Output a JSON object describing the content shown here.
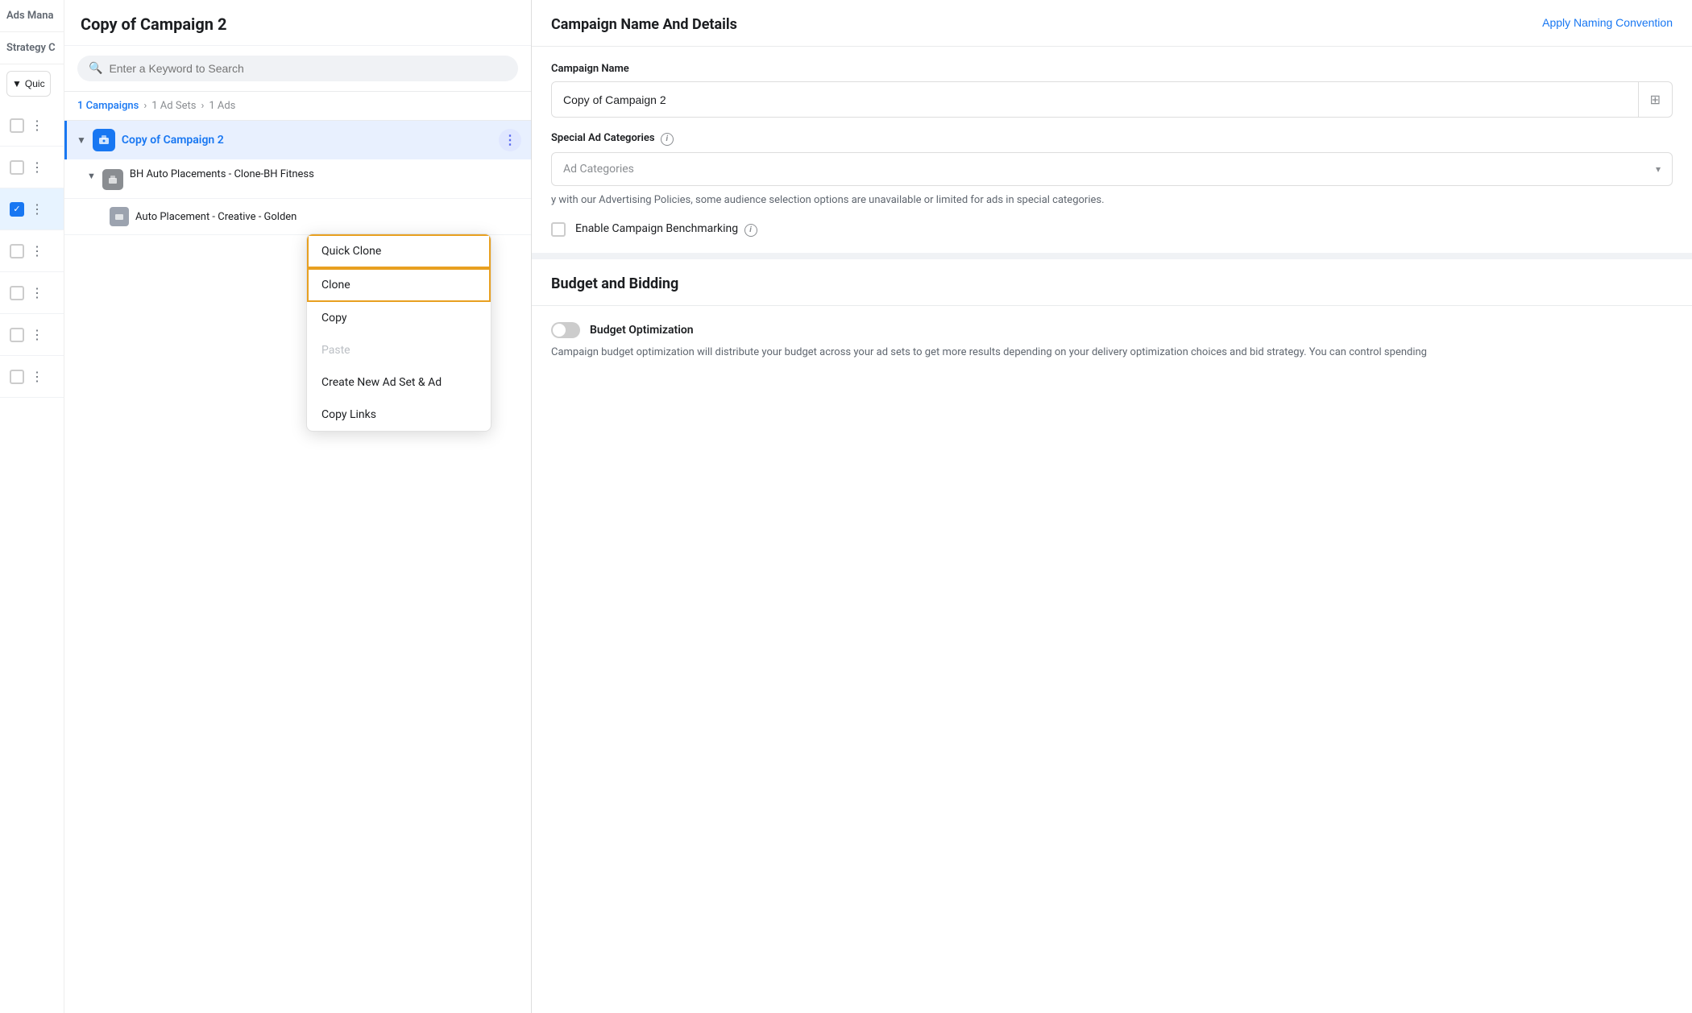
{
  "app": {
    "title": "Ads Mana",
    "panel_title": "Copy of Campaign 2"
  },
  "sidebar": {
    "strategy_label": "Strategy C",
    "quick_btn_label": "Quic",
    "checkboxes": [
      {
        "checked": false
      },
      {
        "checked": false
      },
      {
        "checked": true
      },
      {
        "checked": false
      },
      {
        "checked": false
      },
      {
        "checked": false
      },
      {
        "checked": false
      }
    ]
  },
  "tree_panel": {
    "search_placeholder": "Enter a Keyword to Search",
    "breadcrumb": {
      "campaigns": "1 Campaigns",
      "adsets": "1 Ad Sets",
      "ads": "1 Ads"
    },
    "campaign": {
      "name": "Copy of Campaign 2"
    },
    "adset": {
      "name": "BH Auto Placements - Clone-BH Fitness"
    },
    "ad": {
      "name": "Auto Placement - Creative - Golden"
    }
  },
  "context_menu": {
    "items": [
      {
        "label": "Quick Clone",
        "type": "highlighted"
      },
      {
        "label": "Clone",
        "type": "highlighted"
      },
      {
        "label": "Copy",
        "type": "normal"
      },
      {
        "label": "Paste",
        "type": "disabled"
      },
      {
        "label": "Create New Ad Set & Ad",
        "type": "normal"
      },
      {
        "label": "Copy Links",
        "type": "normal"
      }
    ]
  },
  "right_panel": {
    "section1": {
      "title": "Campaign Name And Details",
      "apply_naming": "Apply Naming Convention",
      "campaign_name_label": "Campaign Name",
      "campaign_name_value": "Copy of Campaign 2",
      "special_ad_label": "Special Ad Categories",
      "special_ad_placeholder": "Ad Categories",
      "helper_text": "y with our Advertising Policies, some audience selection options are unavailable or limited for ads in special categories.",
      "benchmarking_label": "Enable Campaign Benchmarking"
    },
    "section2": {
      "title": "Budget and Bidding",
      "budget_optimization_label": "Budget Optimization",
      "budget_text": "Campaign budget optimization will distribute your budget across your ad sets to get more results depending on your delivery optimization choices and bid strategy. You can control spending"
    }
  }
}
